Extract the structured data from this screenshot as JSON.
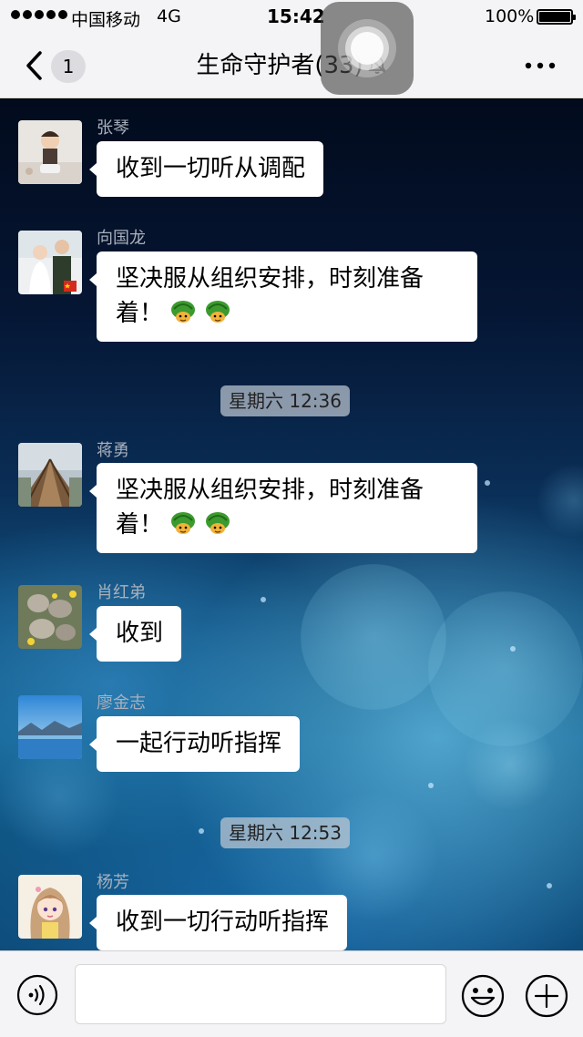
{
  "status_bar": {
    "carrier": "中国移动",
    "network": "4G",
    "time": "15:42",
    "battery": "100%"
  },
  "nav": {
    "unread_count": "1",
    "title": "生命守护者(33)",
    "icons": {
      "back": "chevron-left-icon",
      "mute": "bell-muted-icon",
      "more": "more-dots-icon"
    }
  },
  "messages": [
    {
      "sender": "张琴",
      "text": "收到一切听从调配",
      "emoji_count": 0
    },
    {
      "sender": "向国龙",
      "line1": "坚决服从组织安排，时刻准备",
      "line2": "着！",
      "emoji_count": 2,
      "emoji": "turtle-emoji"
    },
    {
      "sender": "蒋勇",
      "line1": "坚决服从组织安排，时刻准备",
      "line2": "着！",
      "emoji_count": 2,
      "emoji": "turtle-emoji"
    },
    {
      "sender": "肖红弟",
      "text": "收到",
      "emoji_count": 0
    },
    {
      "sender": "廖金志",
      "text": "一起行动听指挥",
      "emoji_count": 0
    },
    {
      "sender": "杨芳",
      "text": "收到一切行动听指挥",
      "emoji_count": 0
    }
  ],
  "timestamps": [
    "星期六 12:36",
    "星期六 12:53"
  ],
  "input_bar": {
    "value": "",
    "placeholder": "",
    "icons": {
      "voice": "voice-icon",
      "emoji": "smiley-icon",
      "more": "plus-icon"
    }
  },
  "colors": {
    "bar_bg": "#f4f4f6",
    "bubble_bg": "#ffffff",
    "sender_name": "#a8b0bc",
    "time_chip_bg": "#bec8d2"
  }
}
